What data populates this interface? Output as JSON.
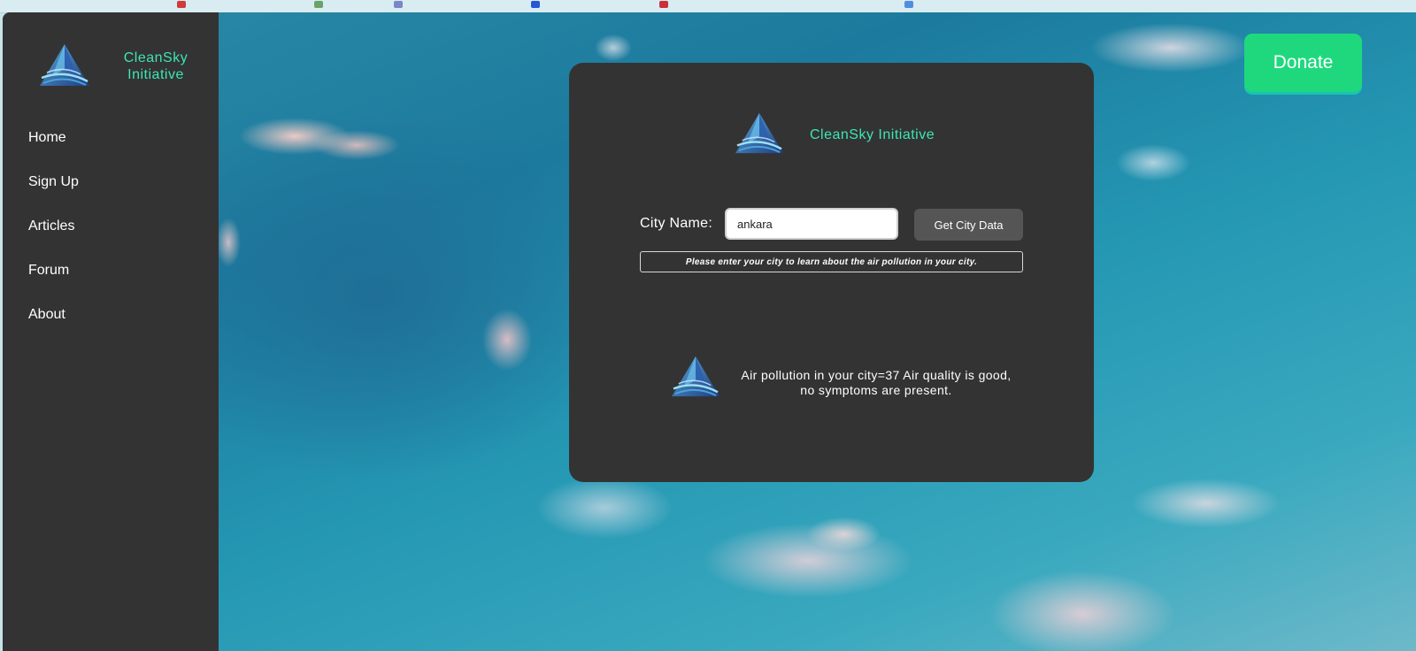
{
  "brand": {
    "name": "CleanSky Initiative",
    "sidebar_line1": "CleanSky",
    "sidebar_line2": "Initiative"
  },
  "colors": {
    "accent": "#3ce6b4",
    "panel": "#333333",
    "donate": "#1fd87e",
    "button": "#555555"
  },
  "icons": {
    "logo": "triangle-waves-logo-icon"
  },
  "sidebar": {
    "items": [
      {
        "label": "Home"
      },
      {
        "label": "Sign Up"
      },
      {
        "label": "Articles"
      },
      {
        "label": "Forum"
      },
      {
        "label": "About"
      }
    ]
  },
  "header": {
    "donate_label": "Donate"
  },
  "form": {
    "city_label": "City Name:",
    "city_value": "ankara",
    "submit_label": "Get City Data",
    "hint": "Please enter your city to learn about the air pollution in your city."
  },
  "result": {
    "text": "Air pollution in your city=37 Air quality is good, no symptoms are present."
  }
}
